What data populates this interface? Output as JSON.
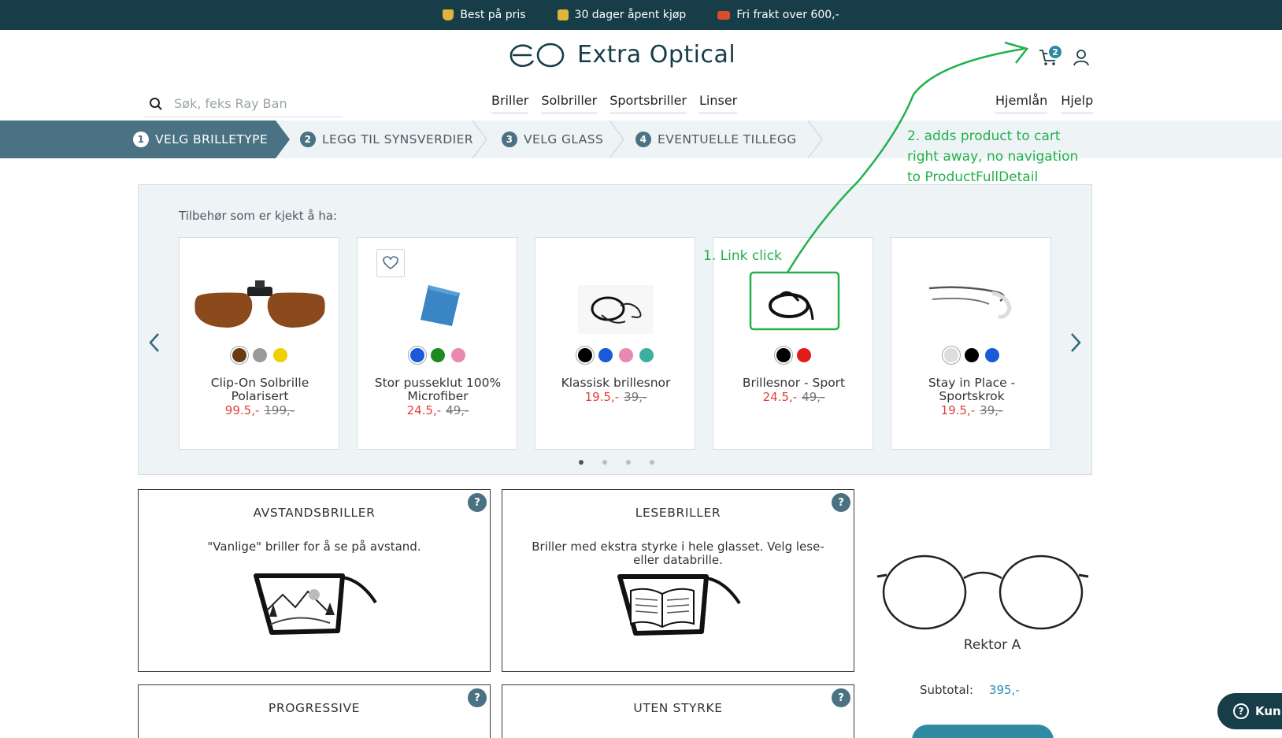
{
  "topbar": {
    "perks": [
      {
        "icon": "trophy-icon",
        "label": "Best på pris",
        "color": "#e0b43a"
      },
      {
        "icon": "wallet-icon",
        "label": "30 dager åpent kjøp",
        "color": "#e0b43a"
      },
      {
        "icon": "truck-icon",
        "label": "Fri frakt over 600,-",
        "color": "#d84d2c"
      }
    ]
  },
  "header": {
    "brand": "Extra Optical",
    "cart_count": "2",
    "search_placeholder": "Søk, feks Ray Ban",
    "nav": [
      "Briller",
      "Solbriller",
      "Sportsbriller",
      "Linser"
    ],
    "nav_right": [
      "Hjemlån",
      "Hjelp"
    ]
  },
  "steps": [
    {
      "num": "1",
      "label": "VELG BRILLETYPE",
      "active": true
    },
    {
      "num": "2",
      "label": "LEGG TIL SYNSVERDIER",
      "active": false
    },
    {
      "num": "3",
      "label": "VELG GLASS",
      "active": false
    },
    {
      "num": "4",
      "label": "EVENTUELLE TILLEGG",
      "active": false
    }
  ],
  "accessories": {
    "title": "Tilbehør som er kjekt å ha:",
    "products": [
      {
        "name": "Clip-On Solbrille Polarisert",
        "price": "99.5,-",
        "old_price": "199,-",
        "colors": [
          "#6b3a10",
          "#9a9a9a",
          "#f0d000"
        ],
        "image": "clip-on-sunglasses-image"
      },
      {
        "name": "Stor pusseklut 100% Microfiber",
        "price": "24.5,-",
        "old_price": "49,-",
        "colors": [
          "#1a5ad8",
          "#1d8a1d",
          "#e988b0"
        ],
        "image": "microfiber-cloth-image",
        "wishlist": true
      },
      {
        "name": "Klassisk brillesnor",
        "price": "19.5,-",
        "old_price": "39,-",
        "colors": [
          "#000000",
          "#1a5ad8",
          "#e988b0",
          "#3cb0a0"
        ],
        "image": "glasses-cord-image"
      },
      {
        "name": "Brillesnor - Sport",
        "price": "24.5,-",
        "old_price": "49,-",
        "colors": [
          "#000000",
          "#e21b1b"
        ],
        "image": "sport-cord-image"
      },
      {
        "name": "Stay in Place - Sportskrok",
        "price": "19.5,-",
        "old_price": "39,-",
        "colors": [
          "#dddddd",
          "#000000",
          "#1a5ad8"
        ],
        "image": "sport-hook-image"
      }
    ],
    "page_dots": 4,
    "active_dot": 0
  },
  "lens_types": [
    {
      "title": "AVSTANDSBRILLER",
      "desc": "\"Vanlige\" briller for å se på avstand."
    },
    {
      "title": "LESEBRILLER",
      "desc": "Briller med ekstra styrke i hele glasset. Velg lese- eller databrille."
    },
    {
      "title": "PROGRESSIVE",
      "desc": ""
    },
    {
      "title": "UTEN STYRKE",
      "desc": ""
    }
  ],
  "preview": {
    "frame_name": "Rektor A",
    "subtotal_label": "Subtotal:",
    "subtotal_value": "395,-"
  },
  "chat": {
    "label": "Kun"
  },
  "annotations": {
    "note1": "1. Link click",
    "note2_lines": [
      "2. adds product to cart",
      "right away, no navigation",
      "to ProductFullDetail"
    ],
    "color": "#22b14c"
  }
}
